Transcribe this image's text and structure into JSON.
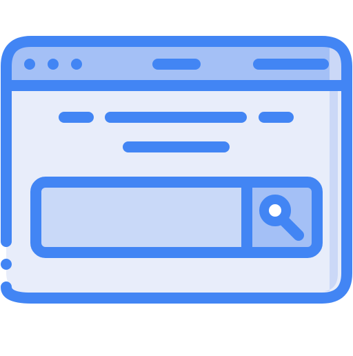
{
  "illustration": {
    "subject": "browser-window-search-icon",
    "colors": {
      "stroke": "#4285F4",
      "window_fill": "#E8EDFA",
      "titlebar_fill": "#A4C0F6",
      "right_shade": "#CBD8F7",
      "search_input_fill": "#C9D9F8",
      "search_button_fill": "#A4C0F6",
      "background": "#FFFFFF"
    },
    "icons": [
      "window-control-dot-icon",
      "search-magnifier-icon"
    ]
  }
}
